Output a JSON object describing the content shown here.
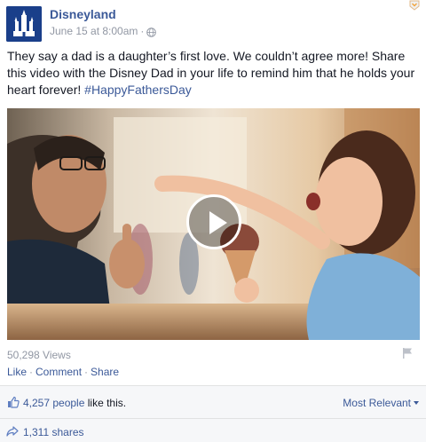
{
  "post": {
    "page_name": "Disneyland",
    "timestamp": "June 15 at 8:00am",
    "meta_separator": "·",
    "text": "They say a dad is a daughter’s first love. We couldn’t agree more! Share this video with the Disney Dad in your life to remind him that he holds your heart forever! ",
    "hashtag": "#HappyFathersDay",
    "icons": {
      "privacy": "globe-icon",
      "menu": "chevron-down-icon",
      "report": "flag-icon",
      "video": "play-icon"
    }
  },
  "video": {
    "description": "father and daughter sharing ice cream",
    "views": "50,298 Views"
  },
  "actions": {
    "like": "Like",
    "comment": "Comment",
    "share": "Share",
    "separator": "·"
  },
  "ufi": {
    "likes_people": "4,257 people",
    "likes_suffix": " like this.",
    "sort_label": "Most Relevant",
    "shares": "1,311 shares",
    "icons": {
      "like": "thumbs-up-icon",
      "share": "share-arrow-icon",
      "sort": "caret-down-icon"
    }
  },
  "colors": {
    "link": "#3b5998",
    "muted": "#9197a3",
    "text": "#141823",
    "footer_bg": "#f6f7f9",
    "brand": "#1a3f8a"
  }
}
